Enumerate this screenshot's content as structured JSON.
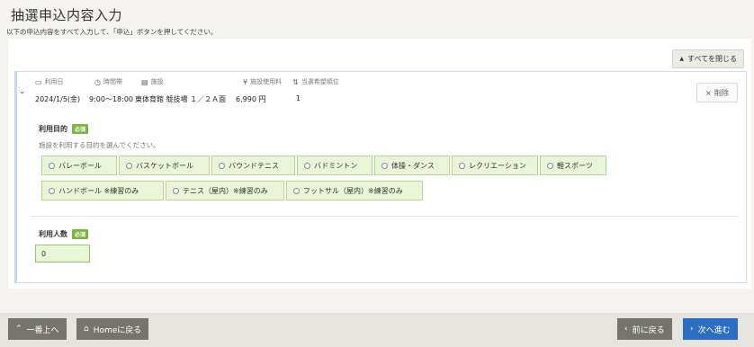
{
  "header": {
    "title": "抽選申込内容入力",
    "subtitle": "以下の申込内容をすべて入力して、「申込」ボタンを押してください。"
  },
  "toolbar": {
    "collapse_all_label": "すべてを閉じる"
  },
  "card": {
    "columns": [
      {
        "label": "利用日",
        "value": "2024/1/5(金)"
      },
      {
        "label": "時間帯",
        "value": "9:00～18:00"
      },
      {
        "label": "施設",
        "value": "東体育館 競技場 １／２Ａ面"
      },
      {
        "label": "施設使用料",
        "value": "6,990 円"
      },
      {
        "label": "当選希望順位",
        "value": "1"
      }
    ],
    "delete_label": "削除"
  },
  "purpose": {
    "label": "利用目的",
    "required_badge": "必須",
    "help": "施設を利用する目的を選んでください。",
    "options": [
      "バレーボール",
      "バスケットボール",
      "バウンドテニス",
      "バドミントン",
      "体操・ダンス",
      "レクリエーション",
      "軽スポーツ",
      "ハンドボール ※練習のみ",
      "テニス（屋内）※練習のみ",
      "フットサル（屋内）※練習のみ"
    ]
  },
  "people": {
    "label": "利用人数",
    "required_badge": "必須",
    "value": "0"
  },
  "footer": {
    "top_label": "一番上へ",
    "home_label": "Homeに戻る",
    "back_label": "前に戻る",
    "next_label": "次へ進む"
  }
}
